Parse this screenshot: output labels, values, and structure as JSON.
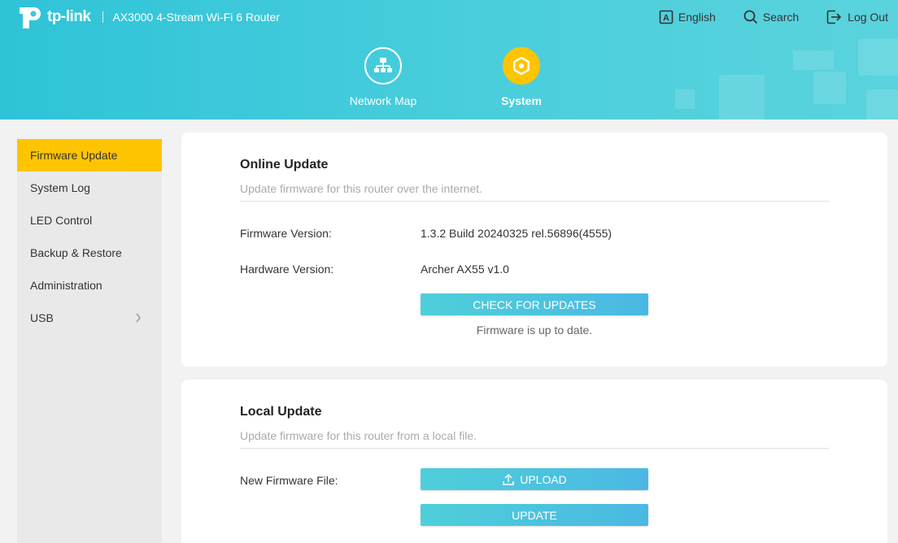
{
  "header": {
    "brand": "tp-link",
    "model": "AX3000 4-Stream Wi-Fi 6 Router",
    "language_label": "English",
    "search_label": "Search",
    "logout_label": "Log Out",
    "nav": [
      {
        "label": "Network Map",
        "icon": "network-map-icon"
      },
      {
        "label": "System",
        "icon": "gear-icon",
        "active": true
      }
    ]
  },
  "sidebar": {
    "items": [
      {
        "label": "Firmware Update",
        "active": true
      },
      {
        "label": "System Log"
      },
      {
        "label": "LED Control"
      },
      {
        "label": "Backup & Restore"
      },
      {
        "label": "Administration"
      },
      {
        "label": "USB",
        "has_chevron": true
      }
    ]
  },
  "online_update": {
    "title": "Online Update",
    "description": "Update firmware for this router over the internet.",
    "firmware_label": "Firmware Version:",
    "firmware_value": "1.3.2 Build 20240325 rel.56896(4555)",
    "hardware_label": "Hardware Version:",
    "hardware_value": "Archer AX55 v1.0",
    "check_button": "CHECK FOR UPDATES",
    "status": "Firmware is up to date."
  },
  "local_update": {
    "title": "Local Update",
    "description": "Update firmware for this router from a local file.",
    "file_label": "New Firmware File:",
    "upload_button": "UPLOAD",
    "update_button": "UPDATE"
  },
  "colors": {
    "header": "#3cc8da",
    "accent": "#ffc400",
    "button": "#4ec3de"
  }
}
